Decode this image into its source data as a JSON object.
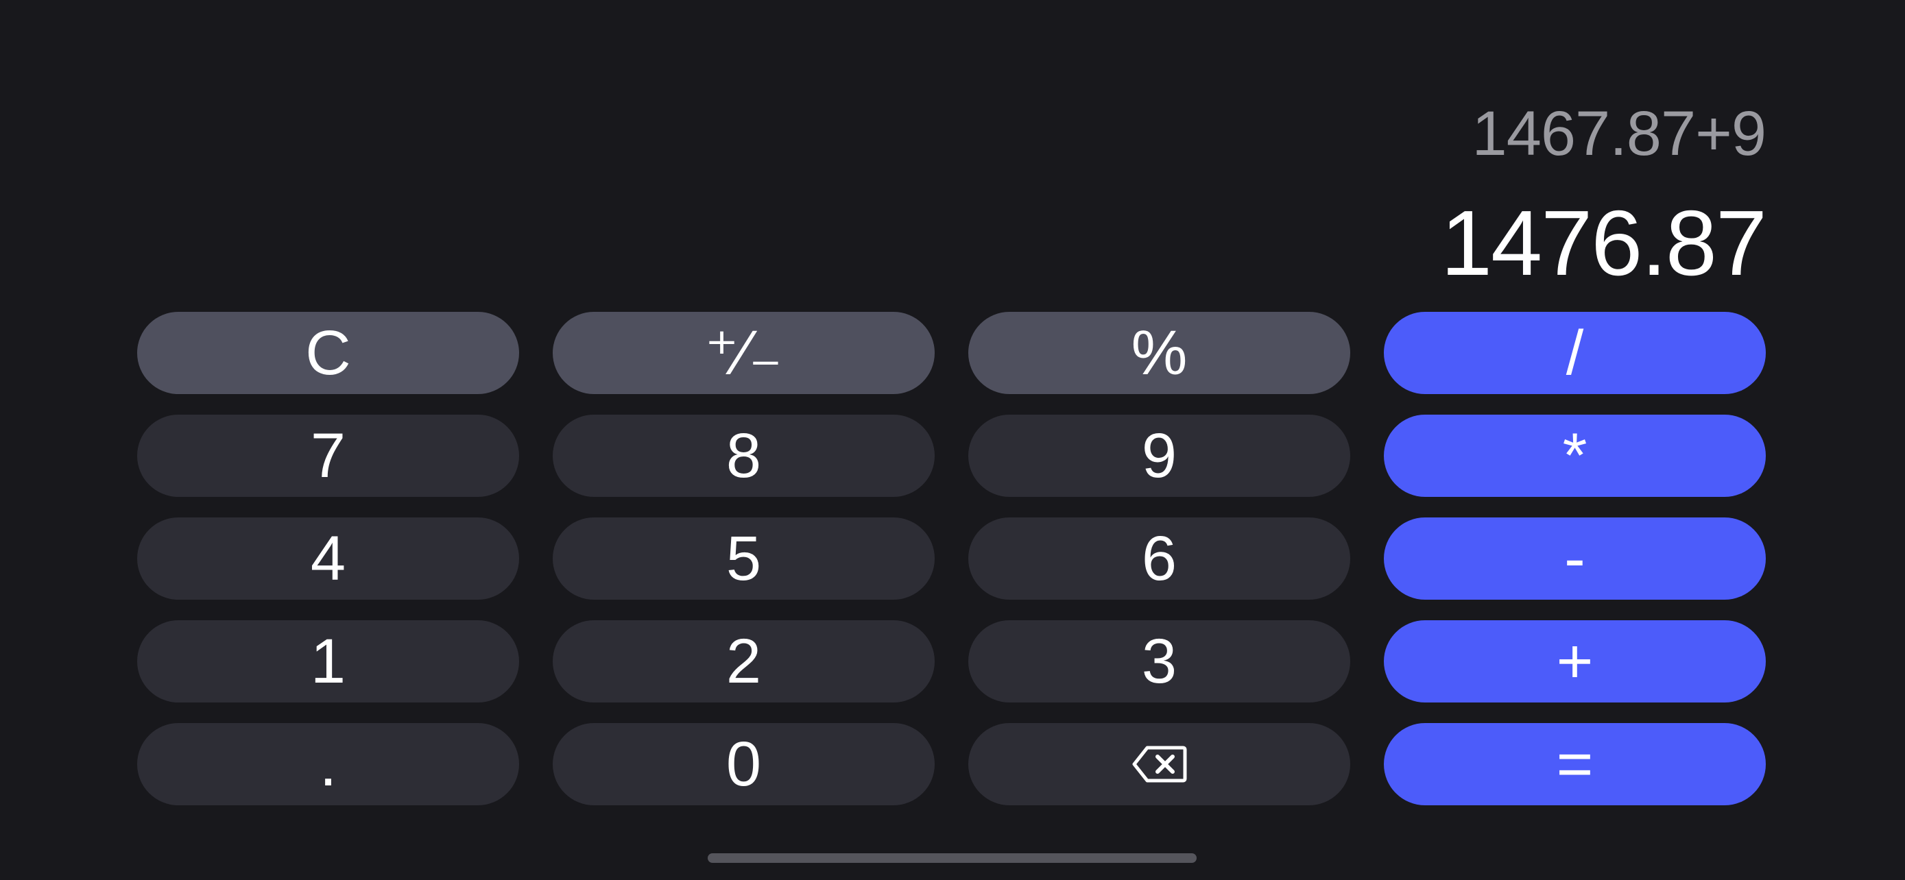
{
  "display": {
    "expression": "1467.87+9",
    "result": "1476.87"
  },
  "colors": {
    "background": "#18181c",
    "function_key": "#4f505e",
    "number_key": "#2d2d35",
    "operator_key": "#4c5cfa",
    "expression_text": "#9a9aa0",
    "result_text": "#ffffff"
  },
  "keys": {
    "clear": "C",
    "sign": "⁺∕₋",
    "percent": "%",
    "divide": "/",
    "seven": "7",
    "eight": "8",
    "nine": "9",
    "multiply": "*",
    "four": "4",
    "five": "5",
    "six": "6",
    "minus": "-",
    "one": "1",
    "two": "2",
    "three": "3",
    "plus": "+",
    "decimal": ".",
    "zero": "0",
    "backspace_icon": "backspace-icon",
    "equals": "="
  }
}
